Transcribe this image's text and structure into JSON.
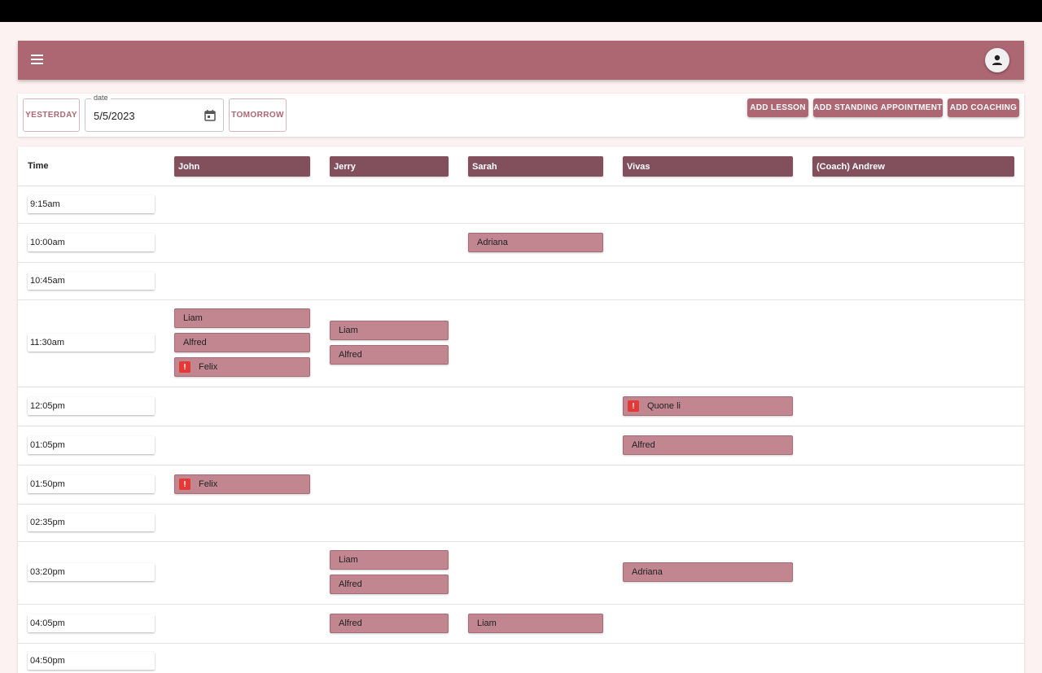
{
  "toolbar": {
    "yesterday_label": "YESTERDAY",
    "date_label": "date",
    "date_value": "5/5/2023",
    "tomorrow_label": "TOMORROW",
    "add_lesson_label": "ADD LESSON",
    "add_standing_label": "ADD STANDING APPOINTMENT",
    "add_coaching_label": "ADD COACHING"
  },
  "schedule": {
    "time_header": "Time",
    "instructors": [
      "John",
      "Jerry",
      "Sarah",
      "Vivas",
      "(Coach) Andrew"
    ],
    "times": [
      "9:15am",
      "10:00am",
      "10:45am",
      "11:30am",
      "12:05pm",
      "01:05pm",
      "01:50pm",
      "02:35pm",
      "03:20pm",
      "04:05pm",
      "04:50pm"
    ],
    "slots": {
      "sarah_1000": "Adriana",
      "john_1130_1": "Liam",
      "john_1130_2": "Alfred",
      "john_1130_3": "Felix",
      "jerry_1130_1": "Liam",
      "jerry_1130_2": "Alfred",
      "vivas_1205": "Quone li",
      "vivas_0105": "Alfred",
      "john_0150": "Felix",
      "jerry_0320_1": "Liam",
      "jerry_0320_2": "Alfred",
      "vivas_0320": "Adriana",
      "jerry_0405": "Alfred",
      "sarah_0405": "Liam"
    },
    "warning_glyph": "!"
  },
  "colors": {
    "appbar": "#ad6773",
    "instructor_header": "#824f5c",
    "slot": "#c18690",
    "warning": "#e53935",
    "background": "#fdf2f2"
  }
}
